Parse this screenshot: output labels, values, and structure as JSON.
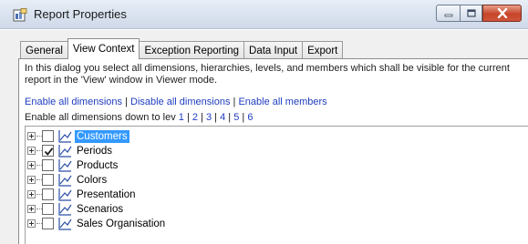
{
  "window": {
    "title": "Report Properties",
    "icon": "report-properties-icon",
    "controls": [
      "minimize-icon",
      "maximize-icon",
      "close-icon"
    ]
  },
  "tabs": [
    {
      "label": "General",
      "active": false
    },
    {
      "label": "View Context",
      "active": true
    },
    {
      "label": "Exception Reporting",
      "active": false
    },
    {
      "label": "Data Input",
      "active": false
    },
    {
      "label": "Export",
      "active": false
    }
  ],
  "view_context": {
    "description": "In this dialog you select all dimensions, hierarchies, levels, and members which shall be visible for the current report in the 'View' window in Viewer mode.",
    "enable_all_dimensions": "Enable all dimensions",
    "separator": " | ",
    "disable_all_dimensions": "Disable all dimensions",
    "enable_all_members": "Enable all members",
    "levels_prefix": "Enable all dimensions down to lev",
    "levels": [
      "1",
      "2",
      "3",
      "4",
      "5",
      "6"
    ],
    "tree": [
      {
        "label": "Customers",
        "checked": false,
        "selected": true
      },
      {
        "label": "Periods",
        "checked": true,
        "selected": false
      },
      {
        "label": "Products",
        "checked": false,
        "selected": false
      },
      {
        "label": "Colors",
        "checked": false,
        "selected": false
      },
      {
        "label": "Presentation",
        "checked": false,
        "selected": false
      },
      {
        "label": "Scenarios",
        "checked": false,
        "selected": false
      },
      {
        "label": "Sales Organisation",
        "checked": false,
        "selected": false
      }
    ]
  },
  "colors": {
    "link": "#1f3dbf",
    "selection": "#3399ff",
    "close_button": "#c6452a"
  }
}
